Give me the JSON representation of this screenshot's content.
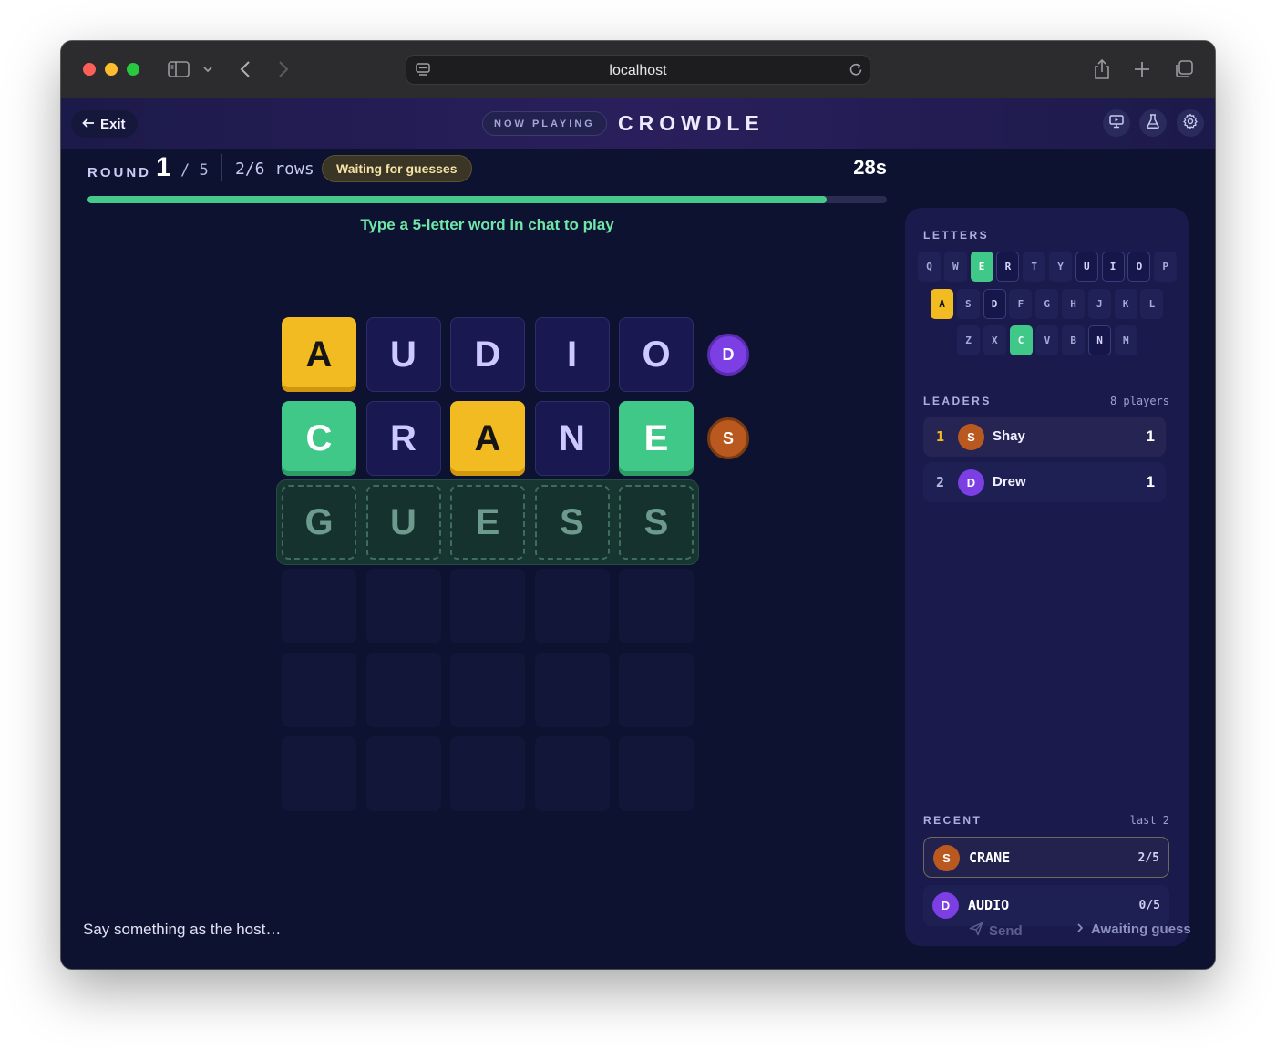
{
  "browser": {
    "url": "localhost"
  },
  "header": {
    "exit_label": "Exit",
    "now_playing": "NOW PLAYING",
    "title": "CROWDLE",
    "icons": [
      "present-icon",
      "flask-icon",
      "gear-icon"
    ]
  },
  "round": {
    "label": "ROUND",
    "current": "1",
    "total": "/ 5",
    "rows": "2/6 rows",
    "status": "Waiting for guesses",
    "timer": "28s",
    "progress": 0.925,
    "hint": "Type a 5-letter word in chat to play"
  },
  "board": {
    "rows": [
      {
        "letters": [
          "A",
          "U",
          "D",
          "I",
          "O"
        ],
        "states": [
          "present",
          "absent",
          "absent",
          "absent",
          "absent"
        ],
        "player_initial": "D",
        "player_color": "#7b3fe4"
      },
      {
        "letters": [
          "C",
          "R",
          "A",
          "N",
          "E"
        ],
        "states": [
          "correct",
          "absent",
          "present",
          "absent",
          "correct"
        ],
        "player_initial": "S",
        "player_color": "#b9591f"
      },
      {
        "letters": [
          "G",
          "U",
          "E",
          "S",
          "S"
        ],
        "states": [
          "pending",
          "pending",
          "pending",
          "pending",
          "pending"
        ]
      },
      {
        "letters": [
          "",
          "",
          "",
          "",
          ""
        ],
        "states": [
          "empty",
          "empty",
          "empty",
          "empty",
          "empty"
        ]
      },
      {
        "letters": [
          "",
          "",
          "",
          "",
          ""
        ],
        "states": [
          "empty",
          "empty",
          "empty",
          "empty",
          "empty"
        ]
      },
      {
        "letters": [
          "",
          "",
          "",
          "",
          ""
        ],
        "states": [
          "empty",
          "empty",
          "empty",
          "empty",
          "empty"
        ]
      }
    ]
  },
  "panel": {
    "letters_heading": "LETTERS",
    "keyboard": [
      [
        {
          "k": "Q",
          "s": "unused"
        },
        {
          "k": "W",
          "s": "unused"
        },
        {
          "k": "E",
          "s": "correct"
        },
        {
          "k": "R",
          "s": "absent"
        },
        {
          "k": "T",
          "s": "unused"
        },
        {
          "k": "Y",
          "s": "unused"
        },
        {
          "k": "U",
          "s": "absent"
        },
        {
          "k": "I",
          "s": "absent"
        },
        {
          "k": "O",
          "s": "absent"
        },
        {
          "k": "P",
          "s": "unused"
        }
      ],
      [
        {
          "k": "A",
          "s": "present"
        },
        {
          "k": "S",
          "s": "unused"
        },
        {
          "k": "D",
          "s": "absent"
        },
        {
          "k": "F",
          "s": "unused"
        },
        {
          "k": "G",
          "s": "unused"
        },
        {
          "k": "H",
          "s": "unused"
        },
        {
          "k": "J",
          "s": "unused"
        },
        {
          "k": "K",
          "s": "unused"
        },
        {
          "k": "L",
          "s": "unused"
        }
      ],
      [
        {
          "k": "Z",
          "s": "unused"
        },
        {
          "k": "X",
          "s": "unused"
        },
        {
          "k": "C",
          "s": "correct"
        },
        {
          "k": "V",
          "s": "unused"
        },
        {
          "k": "B",
          "s": "unused"
        },
        {
          "k": "N",
          "s": "absent"
        },
        {
          "k": "M",
          "s": "unused"
        }
      ]
    ],
    "leaders_heading": "LEADERS",
    "leaders_meta": "8 players",
    "leaders": [
      {
        "rank": "1",
        "initial": "S",
        "name": "Shay",
        "score": "1",
        "color": "#b9591f",
        "rank_color": "#f2bb21"
      },
      {
        "rank": "2",
        "initial": "D",
        "name": "Drew",
        "score": "1",
        "color": "#7b3fe4",
        "rank_color": "#b5b7de"
      }
    ],
    "recent_heading": "RECENT",
    "recent_meta": "last 2",
    "recent": [
      {
        "initial": "S",
        "word": "CRANE",
        "score": "2/5",
        "color": "#b9591f"
      },
      {
        "initial": "D",
        "word": "AUDIO",
        "score": "0/5",
        "color": "#7b3fe4"
      }
    ]
  },
  "footer": {
    "chat_placeholder": "Say something as the host…",
    "send_label": "Send",
    "awaiting_label": "Awaiting guess"
  }
}
